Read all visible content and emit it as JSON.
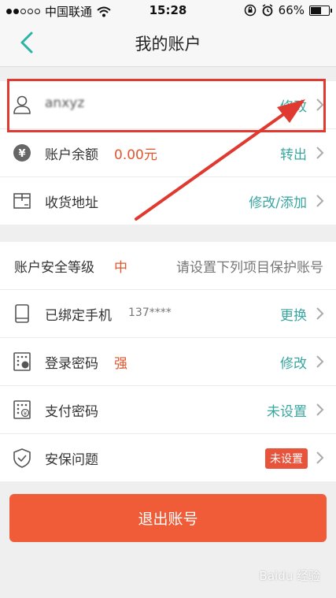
{
  "status": {
    "carrier": "中国联通",
    "time": "15:28",
    "battery": "66%",
    "battery_level": 0.66
  },
  "nav": {
    "title": "我的账户"
  },
  "account": {
    "username": "anxyz",
    "username_action": "修改",
    "balance_label": "账户余额",
    "balance_value": "0.00元",
    "balance_action": "转出",
    "address_label": "收货地址",
    "address_action": "修改/添加"
  },
  "security": {
    "level_label": "账户安全等级",
    "level_value": "中",
    "level_hint": "请设置下列项目保护账号",
    "phone_label": "已绑定手机",
    "phone_value": "137****",
    "phone_action": "更换",
    "login_pwd_label": "登录密码",
    "login_pwd_strength": "强",
    "login_pwd_action": "修改",
    "pay_pwd_label": "支付密码",
    "pay_pwd_action": "未设置",
    "question_label": "安保问题",
    "question_badge": "未设置"
  },
  "logout_label": "退出账号",
  "watermark": "Baidu 经验",
  "colors": {
    "accent": "#3aa6a0",
    "danger": "#e2552d",
    "button": "#f05b38",
    "annotation": "#e0392f"
  }
}
